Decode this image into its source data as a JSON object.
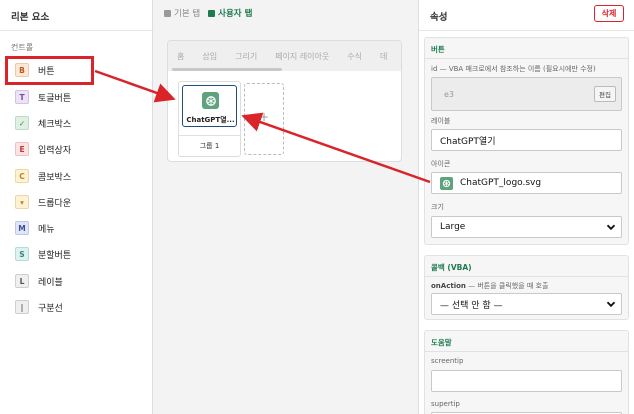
{
  "left_panel": {
    "title": "리본 요소",
    "section_label": "컨트롤",
    "controls": [
      {
        "letter": "B",
        "label": "버튼",
        "bg": "#fde8d8",
        "fg": "#c0561b"
      },
      {
        "letter": "T",
        "label": "토글버튼",
        "bg": "#ece3f4",
        "fg": "#7a4aa0"
      },
      {
        "letter": "✓",
        "label": "체크박스",
        "bg": "#e0f1e4",
        "fg": "#2e8a47"
      },
      {
        "letter": "E",
        "label": "입력상자",
        "bg": "#fbe3e3",
        "fg": "#c03a3a"
      },
      {
        "letter": "C",
        "label": "콤보박스",
        "bg": "#fdf1d6",
        "fg": "#b9860f"
      },
      {
        "letter": "▾",
        "label": "드롭다운",
        "bg": "#fdf1d6",
        "fg": "#b9860f"
      },
      {
        "letter": "M",
        "label": "메뉴",
        "bg": "#e1e6f6",
        "fg": "#3a4fa0"
      },
      {
        "letter": "S",
        "label": "분할버튼",
        "bg": "#dff2f0",
        "fg": "#2b8a80"
      },
      {
        "letter": "L",
        "label": "레이블",
        "bg": "#efefef",
        "fg": "#555555"
      },
      {
        "letter": "|",
        "label": "구분선",
        "bg": "#efefef",
        "fg": "#555555"
      }
    ]
  },
  "tabs": [
    {
      "label": "기본 탭",
      "active": false
    },
    {
      "label": "사용자 탭",
      "active": true
    }
  ],
  "ribbon": {
    "tabs": [
      "홈",
      "삽입",
      "그리기",
      "페이지 레이아웃",
      "수식",
      "데"
    ],
    "group": {
      "button_label": "ChatGPT열...",
      "name": "그룹 1"
    },
    "add_symbol": "+"
  },
  "properties": {
    "title": "속성",
    "delete_label": "삭제",
    "button_section": {
      "title": "버튼",
      "id_label": "id — VBA 매크로에서 참조하는 이름 (필요시에만 수정)",
      "id_value": "e3",
      "edit_label": "편집",
      "label_label": "레이블",
      "label_value": "ChatGPT열기",
      "icon_label": "아이콘",
      "icon_value": "ChatGPT_logo.svg",
      "size_label": "크기",
      "size_value": "Large"
    },
    "callback_section": {
      "title": "콜백 (VBA)",
      "onaction_name": "onAction",
      "onaction_desc": "— 버튼을 클릭했을 때 호출",
      "onaction_value": "— 선택 안 함 —"
    },
    "help_section": {
      "title": "도움말",
      "screentip_label": "screentip",
      "supertip_label": "supertip"
    }
  },
  "colors": {
    "accent_green": "#1e7b4f",
    "highlight_red": "#d9252a",
    "chatgpt_green": "#5fa37e"
  }
}
